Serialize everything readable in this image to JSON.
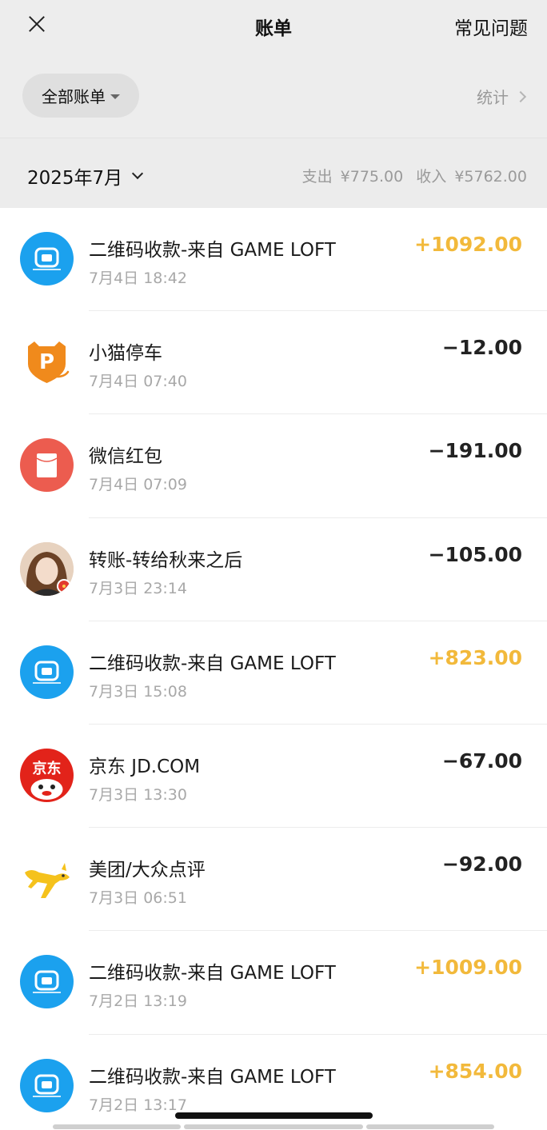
{
  "header": {
    "title": "账单",
    "faq_label": "常见问题"
  },
  "filter": {
    "all_bills_label": "全部账单",
    "stats_label": "统计"
  },
  "month": {
    "label": "2025年7月",
    "expense_label": "支出",
    "expense_value": "¥775.00",
    "income_label": "收入",
    "income_value": "¥5762.00"
  },
  "colors": {
    "income": "#f2b93b",
    "expense": "#222222",
    "gameloft": "#1ba1ee",
    "hongbao": "#ec5c4f",
    "jd": "#e2231a"
  },
  "transactions": [
    {
      "icon": "gameloft-icon",
      "title": "二维码收款-来自 GAME LOFT",
      "time": "7月4日 18:42",
      "amount": "+1092.00",
      "type": "income"
    },
    {
      "icon": "parking-icon",
      "title": "小猫停车",
      "time": "7月4日 07:40",
      "amount": "−12.00",
      "type": "expense"
    },
    {
      "icon": "red-envelope-icon",
      "title": "微信红包",
      "time": "7月4日 07:09",
      "amount": "−191.00",
      "type": "expense"
    },
    {
      "icon": "user-avatar-icon",
      "title": "转账-转给秋来之后",
      "time": "7月3日 23:14",
      "amount": "−105.00",
      "type": "expense"
    },
    {
      "icon": "gameloft-icon",
      "title": "二维码收款-来自 GAME LOFT",
      "time": "7月3日 15:08",
      "amount": "+823.00",
      "type": "income"
    },
    {
      "icon": "jd-icon",
      "title": "京东 JD.COM",
      "time": "7月3日 13:30",
      "amount": "−67.00",
      "type": "expense"
    },
    {
      "icon": "meituan-icon",
      "title": "美团/大众点评",
      "time": "7月3日 06:51",
      "amount": "−92.00",
      "type": "expense"
    },
    {
      "icon": "gameloft-icon",
      "title": "二维码收款-来自 GAME LOFT",
      "time": "7月2日 13:19",
      "amount": "+1009.00",
      "type": "income"
    },
    {
      "icon": "gameloft-icon",
      "title": "二维码收款-来自 GAME LOFT",
      "time": "7月2日 13:17",
      "amount": "+854.00",
      "type": "income"
    }
  ]
}
